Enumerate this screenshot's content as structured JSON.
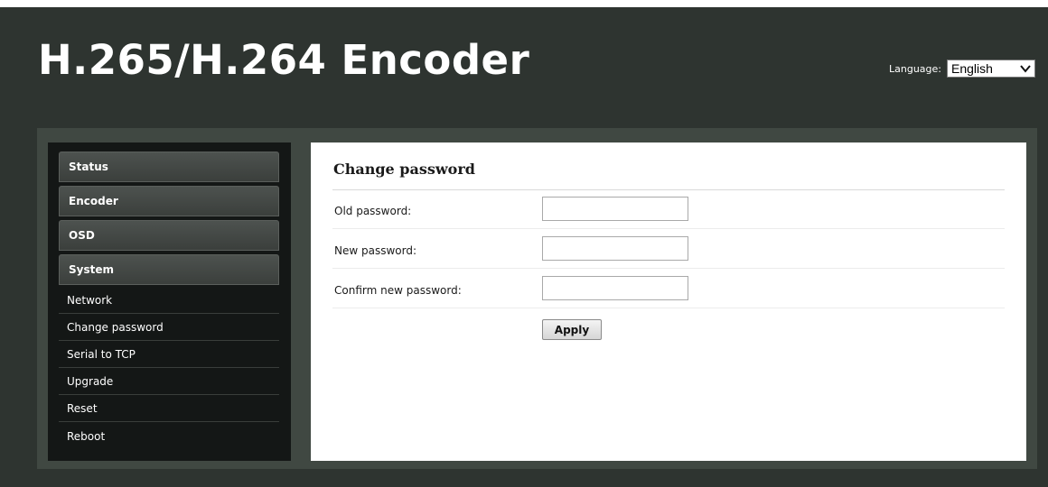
{
  "header": {
    "title": "H.265/H.264 Encoder",
    "language_label": "Language:",
    "language_selected": "English"
  },
  "sidebar": {
    "items": [
      {
        "label": "Status",
        "type": "header"
      },
      {
        "label": "Encoder",
        "type": "header"
      },
      {
        "label": "OSD",
        "type": "header"
      },
      {
        "label": "System",
        "type": "header"
      },
      {
        "label": "Network",
        "type": "sub"
      },
      {
        "label": "Change password",
        "type": "sub"
      },
      {
        "label": "Serial to TCP",
        "type": "sub"
      },
      {
        "label": "Upgrade",
        "type": "sub"
      },
      {
        "label": "Reset",
        "type": "sub"
      },
      {
        "label": "Reboot",
        "type": "sub"
      }
    ]
  },
  "main": {
    "title": "Change password",
    "old_password_label": "Old password:",
    "old_password_value": "",
    "new_password_label": "New password:",
    "new_password_value": "",
    "confirm_password_label": "Confirm new password:",
    "confirm_password_value": "",
    "apply_label": "Apply"
  },
  "colors": {
    "page_background": "#2e3430",
    "frame": "#404842",
    "sidebar": "#141716",
    "content": "#ffffff"
  },
  "icons": {
    "language_dropdown": "chevron-down-icon"
  }
}
